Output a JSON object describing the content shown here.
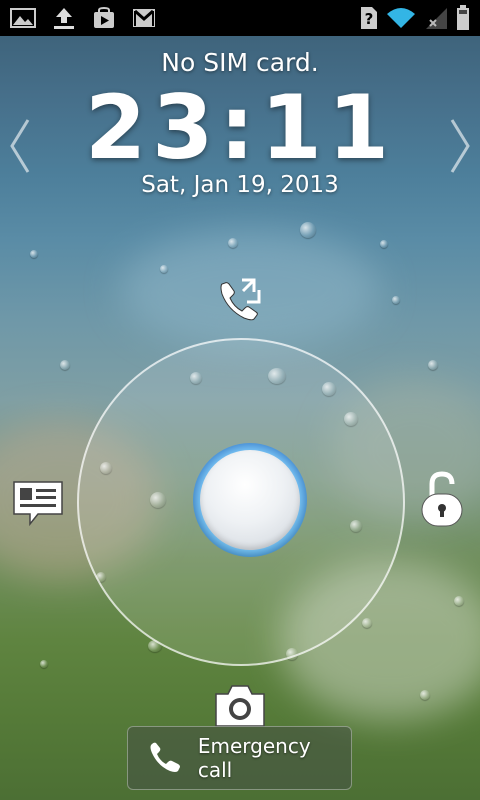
{
  "status_bar": {
    "left_icons": [
      "picture-icon",
      "upload-icon",
      "play-store-icon",
      "gmail-icon"
    ],
    "right_icons": [
      "no-sim-icon",
      "wifi-icon",
      "signal-off-icon",
      "battery-icon"
    ]
  },
  "lock_screen": {
    "carrier_text": "No SIM card.",
    "time": "23:11",
    "date": "Sat, Jan 19, 2013",
    "targets": [
      "call-log-icon",
      "message-icon",
      "unlock-icon",
      "camera-icon"
    ]
  },
  "emergency": {
    "label": "Emergency call"
  },
  "colors": {
    "status_bar": "#000000",
    "wifi": "#33b5e5",
    "handle_glow": "#2a8cff"
  }
}
